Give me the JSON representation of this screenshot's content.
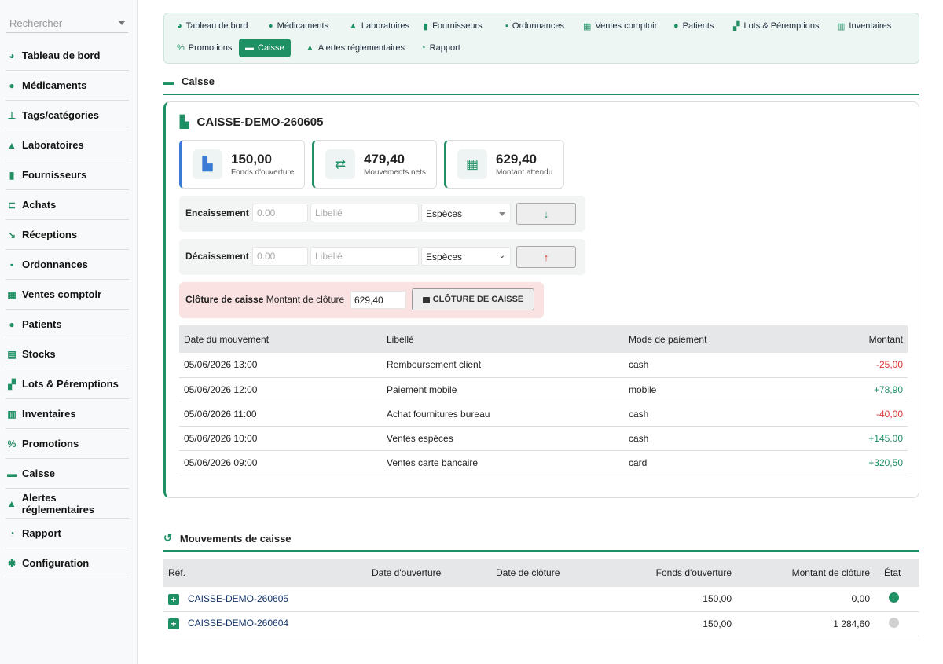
{
  "sidebar": {
    "search_placeholder": "Rechercher",
    "items": [
      {
        "label": "Tableau de bord",
        "icon": "gauge-icon",
        "glyph": "◕"
      },
      {
        "label": "Médicaments",
        "icon": "pills-icon",
        "glyph": "●"
      },
      {
        "label": "Tags/catégories",
        "icon": "sitemap-icon",
        "glyph": "⊥"
      },
      {
        "label": "Laboratoires",
        "icon": "flask-icon",
        "glyph": "▲"
      },
      {
        "label": "Fournisseurs",
        "icon": "truck-icon",
        "glyph": "▮"
      },
      {
        "label": "Achats",
        "icon": "cart-icon",
        "glyph": "⊏"
      },
      {
        "label": "Réceptions",
        "icon": "dolly-icon",
        "glyph": "↘"
      },
      {
        "label": "Ordonnances",
        "icon": "prescription-icon",
        "glyph": "▪"
      },
      {
        "label": "Ventes comptoir",
        "icon": "cash-register-icon",
        "glyph": "▦"
      },
      {
        "label": "Patients",
        "icon": "user-injured-icon",
        "glyph": "●"
      },
      {
        "label": "Stocks",
        "icon": "warehouse-icon",
        "glyph": "▤"
      },
      {
        "label": "Lots & Péremptions",
        "icon": "boxes-icon",
        "glyph": "▞"
      },
      {
        "label": "Inventaires",
        "icon": "clipboard-list-icon",
        "glyph": "▥"
      },
      {
        "label": "Promotions",
        "icon": "percent-icon",
        "glyph": "%"
      },
      {
        "label": "Caisse",
        "icon": "money-bill-icon",
        "glyph": "▬"
      },
      {
        "label": "Alertes réglementaires",
        "icon": "warning-icon",
        "glyph": "▲"
      },
      {
        "label": "Rapport",
        "icon": "chart-pie-icon",
        "glyph": "◔"
      },
      {
        "label": "Configuration",
        "icon": "gear-icon",
        "glyph": "✱"
      }
    ]
  },
  "topnav": {
    "tabs": [
      {
        "label": "Tableau de bord",
        "icon": "gauge-icon",
        "glyph": "◕"
      },
      {
        "label": "Médicaments",
        "icon": "pills-icon",
        "glyph": "●"
      },
      {
        "label": "Laboratoires",
        "icon": "flask-icon",
        "glyph": "▲"
      },
      {
        "label": "Fournisseurs",
        "icon": "truck-icon",
        "glyph": "▮"
      },
      {
        "label": "Ordonnances",
        "icon": "prescription-icon",
        "glyph": "▪"
      },
      {
        "label": "Ventes comptoir",
        "icon": "cash-register-icon",
        "glyph": "▦"
      },
      {
        "label": "Patients",
        "icon": "user-injured-icon",
        "glyph": "●"
      },
      {
        "label": "Lots & Péremptions",
        "icon": "boxes-icon",
        "glyph": "▞"
      },
      {
        "label": "Inventaires",
        "icon": "clipboard-list-icon",
        "glyph": "▥"
      },
      {
        "label": "Promotions",
        "icon": "percent-icon",
        "glyph": "%"
      },
      {
        "label": "Caisse",
        "icon": "money-bill-icon",
        "glyph": "▬",
        "active": true
      },
      {
        "label": "Alertes réglementaires",
        "icon": "warning-icon",
        "glyph": "▲"
      },
      {
        "label": "Rapport",
        "icon": "chart-pie-icon",
        "glyph": "◔"
      }
    ]
  },
  "caisse": {
    "section_title": "Caisse",
    "session_title": "CAISSE-DEMO-260605",
    "stats": [
      {
        "value": "150,00",
        "label": "Fonds d'ouverture",
        "icon": "cash-register-icon",
        "glyph": "▙",
        "color": "#3a7bd5"
      },
      {
        "value": "479,40",
        "label": "Mouvements nets",
        "icon": "exchange-icon",
        "glyph": "⇄",
        "color": "#1f8f64"
      },
      {
        "value": "629,40",
        "label": "Montant attendu",
        "icon": "calculator-icon",
        "glyph": "▦",
        "color": "#1f8f64"
      }
    ],
    "encaissement": {
      "label": "Encaissement",
      "amount_placeholder": "0.00",
      "libelle_placeholder": "Libellé",
      "mode": "Espèces",
      "button_glyph": "↓"
    },
    "decaissement": {
      "label": "Décaissement",
      "amount_placeholder": "0.00",
      "libelle_placeholder": "Libellé",
      "mode": "Espèces",
      "button_glyph": "↑"
    },
    "cloture": {
      "label_bold": "Clôture de caisse",
      "label": "Montant de clôture",
      "amount": "629,40",
      "button": "CLÔTURE DE CAISSE"
    },
    "movements": {
      "headers": [
        "Date du mouvement",
        "Libellé",
        "Mode de paiement",
        "Montant"
      ],
      "rows": [
        {
          "date": "05/06/2026 13:00",
          "libelle": "Remboursement client",
          "mode": "cash",
          "montant": "-25,00",
          "sign": "neg"
        },
        {
          "date": "05/06/2026 12:00",
          "libelle": "Paiement mobile",
          "mode": "mobile",
          "montant": "+78,90",
          "sign": "pos"
        },
        {
          "date": "05/06/2026 11:00",
          "libelle": "Achat fournitures bureau",
          "mode": "cash",
          "montant": "-40,00",
          "sign": "neg"
        },
        {
          "date": "05/06/2026 10:00",
          "libelle": "Ventes espèces",
          "mode": "cash",
          "montant": "+145,00",
          "sign": "pos"
        },
        {
          "date": "05/06/2026 09:00",
          "libelle": "Ventes carte bancaire",
          "mode": "card",
          "montant": "+320,50",
          "sign": "pos"
        }
      ]
    }
  },
  "history": {
    "section_title": "Mouvements de caisse",
    "headers": [
      "Réf.",
      "Date d'ouverture",
      "Date de clôture",
      "Fonds d'ouverture",
      "Montant de clôture",
      "État"
    ],
    "rows": [
      {
        "ref": "CAISSE-DEMO-260605",
        "ouverture": "",
        "cloture": "",
        "fonds": "150,00",
        "montant": "0,00",
        "state_color": "#1f8f64"
      },
      {
        "ref": "CAISSE-DEMO-260604",
        "ouverture": "",
        "cloture": "",
        "fonds": "150,00",
        "montant": "1 284,60",
        "state_color": "#d0d0d0"
      }
    ]
  }
}
